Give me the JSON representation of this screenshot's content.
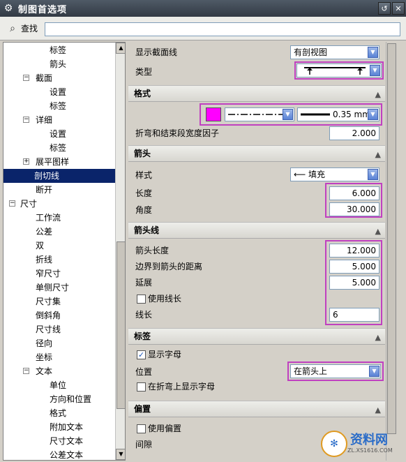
{
  "title": "制图首选项",
  "find": {
    "label": "查找",
    "value": ""
  },
  "tree": [
    {
      "label": "标签",
      "level": 2,
      "expander": ""
    },
    {
      "label": "箭头",
      "level": 2,
      "expander": ""
    },
    {
      "label": "截面",
      "level": 1,
      "expander": "−"
    },
    {
      "label": "设置",
      "level": 2,
      "expander": ""
    },
    {
      "label": "标签",
      "level": 2,
      "expander": ""
    },
    {
      "label": "详细",
      "level": 1,
      "expander": "−"
    },
    {
      "label": "设置",
      "level": 2,
      "expander": ""
    },
    {
      "label": "标签",
      "level": 2,
      "expander": ""
    },
    {
      "label": "展平图样",
      "level": 1,
      "expander": "+"
    },
    {
      "label": "剖切线",
      "level": 1,
      "expander": "",
      "selected": true
    },
    {
      "label": "断开",
      "level": 1,
      "expander": ""
    },
    {
      "label": "尺寸",
      "level": 0,
      "expander": "−"
    },
    {
      "label": "工作流",
      "level": 1,
      "expander": ""
    },
    {
      "label": "公差",
      "level": 1,
      "expander": ""
    },
    {
      "label": "双",
      "level": 1,
      "expander": ""
    },
    {
      "label": "折线",
      "level": 1,
      "expander": ""
    },
    {
      "label": "窄尺寸",
      "level": 1,
      "expander": ""
    },
    {
      "label": "单侧尺寸",
      "level": 1,
      "expander": ""
    },
    {
      "label": "尺寸集",
      "level": 1,
      "expander": ""
    },
    {
      "label": "倒斜角",
      "level": 1,
      "expander": ""
    },
    {
      "label": "尺寸线",
      "level": 1,
      "expander": ""
    },
    {
      "label": "径向",
      "level": 1,
      "expander": ""
    },
    {
      "label": "坐标",
      "level": 1,
      "expander": ""
    },
    {
      "label": "文本",
      "level": 1,
      "expander": "−"
    },
    {
      "label": "单位",
      "level": 2,
      "expander": ""
    },
    {
      "label": "方向和位置",
      "level": 2,
      "expander": ""
    },
    {
      "label": "格式",
      "level": 2,
      "expander": ""
    },
    {
      "label": "附加文本",
      "level": 2,
      "expander": ""
    },
    {
      "label": "尺寸文本",
      "level": 2,
      "expander": ""
    },
    {
      "label": "公差文本",
      "level": 2,
      "expander": ""
    }
  ],
  "top": {
    "show_section_label": "显示截面线",
    "show_section_value": "有剖视图",
    "type_label": "类型"
  },
  "format": {
    "header": "格式",
    "line_width": "0.35 mm",
    "factor_label": "折弯和结束段宽度因子",
    "factor_value": "2.000",
    "color": "#ff00ff"
  },
  "arrow": {
    "header": "箭头",
    "style_label": "样式",
    "style_value": "填充",
    "length_label": "长度",
    "length_value": "6.000",
    "angle_label": "角度",
    "angle_value": "30.000"
  },
  "arrowline": {
    "header": "箭头线",
    "len_label": "箭头长度",
    "len_value": "12.000",
    "border_label": "边界到箭头的距离",
    "border_value": "5.000",
    "ext_label": "延展",
    "ext_value": "5.000",
    "use_len_label": "使用线长",
    "line_len_label": "线长",
    "line_len_value": "6"
  },
  "label": {
    "header": "标签",
    "show_letter_label": "显示字母",
    "pos_label": "位置",
    "pos_value": "在箭头上",
    "bend_label": "在折弯上显示字母"
  },
  "offset": {
    "header": "偏置",
    "use_offset_label": "使用偏置",
    "gap_label": "间隙"
  },
  "watermark": {
    "text": "资料网",
    "url": "ZL.XS1616.COM"
  }
}
